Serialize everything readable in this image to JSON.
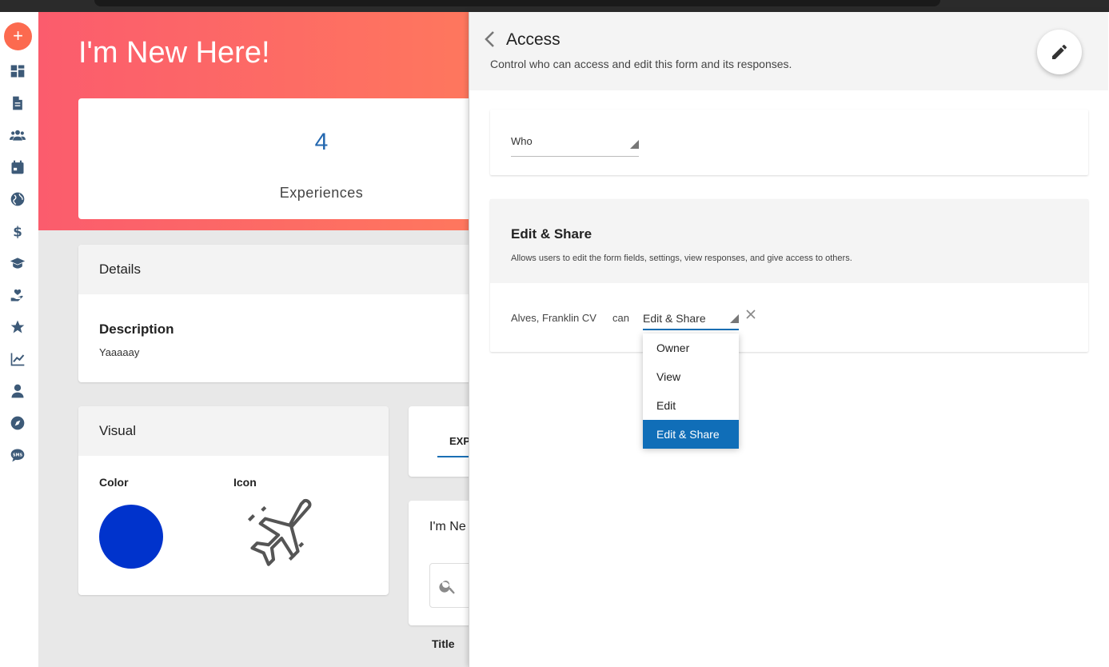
{
  "colors": {
    "accent": "#106eb8",
    "hero_start": "#fb5c6d",
    "hero_end": "#ff7a5c",
    "fab": "#fc6a4f",
    "experience_color": "#0033cc"
  },
  "rail": {
    "add_icon": "plus-icon",
    "icons": [
      "dashboard-icon",
      "document-icon",
      "people-icon",
      "calendar-icon",
      "globe-icon",
      "dollar-icon",
      "graduation-cap-icon",
      "heart-hand-icon",
      "star-icon",
      "chart-line-icon",
      "person-icon",
      "compass-icon",
      "sms-icon"
    ]
  },
  "hero": {
    "title": "I'm New Here!"
  },
  "stats": {
    "value": "4",
    "label": "Experiences"
  },
  "details": {
    "header": "Details",
    "description_label": "Description",
    "description_value": "Yaaaaay"
  },
  "visual": {
    "header": "Visual",
    "color_label": "Color",
    "icon_label": "Icon",
    "icon_name": "airplane-icon"
  },
  "tabs": {
    "active_label": "EXP"
  },
  "list": {
    "title": "I'm Ne",
    "column_title": "Title"
  },
  "panel": {
    "title": "Access",
    "subtitle": "Control who can access and edit this form and its responses.",
    "who_label": "Who",
    "section_title": "Edit & Share",
    "section_desc": "Allows users to edit the form fields, settings, view responses, and give access to others.",
    "person": "Alves, Franklin CV",
    "can_label": "can",
    "permission_selected": "Edit & Share",
    "permission_options": [
      "Owner",
      "View",
      "Edit",
      "Edit & Share"
    ]
  }
}
